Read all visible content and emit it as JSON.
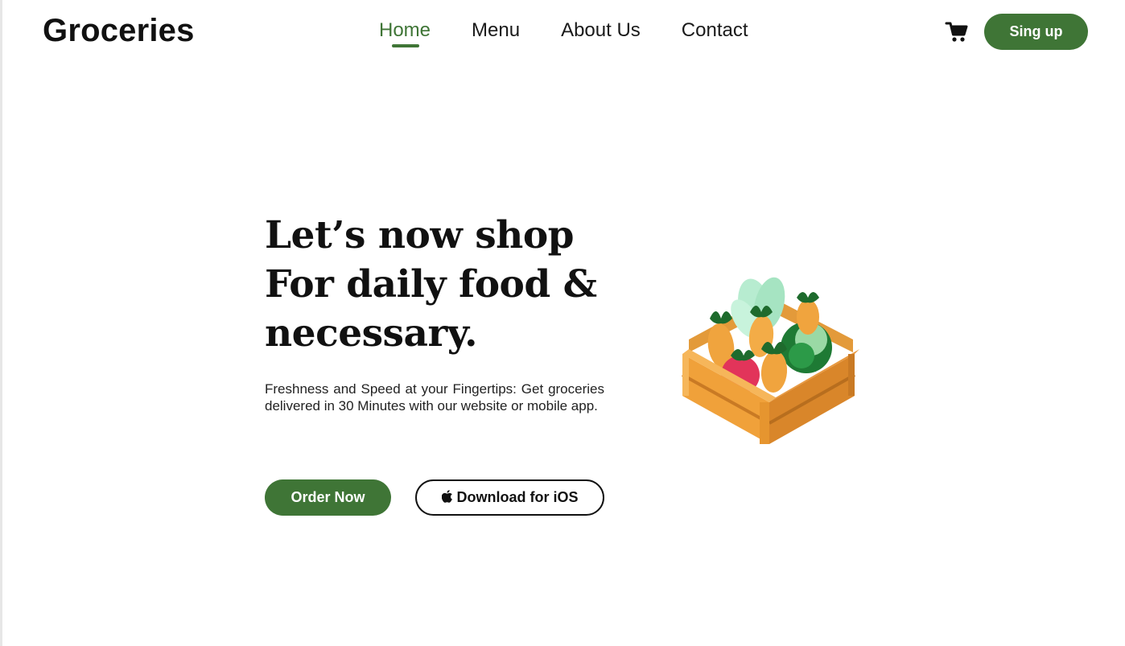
{
  "header": {
    "logo": "Groceries",
    "nav": [
      {
        "label": "Home",
        "active": true
      },
      {
        "label": "Menu",
        "active": false
      },
      {
        "label": "About Us",
        "active": false
      },
      {
        "label": "Contact",
        "active": false
      }
    ],
    "cart_icon": "shopping-cart-icon",
    "signup_label": "Sing up"
  },
  "hero": {
    "title_lines": [
      "Let’s now shop",
      "For daily food &",
      "necessary."
    ],
    "description": "Freshness and Speed at your Fingertips: Get groceries delivered in 30 Minutes with our website or mobile app.",
    "order_button": "Order Now",
    "ios_button": "Download for iOS",
    "ios_icon": "apple-icon",
    "image": "vegetable-crate-illustration"
  },
  "colors": {
    "brand_green": "#3f7536",
    "text": "#111111",
    "background": "#ffffff"
  }
}
